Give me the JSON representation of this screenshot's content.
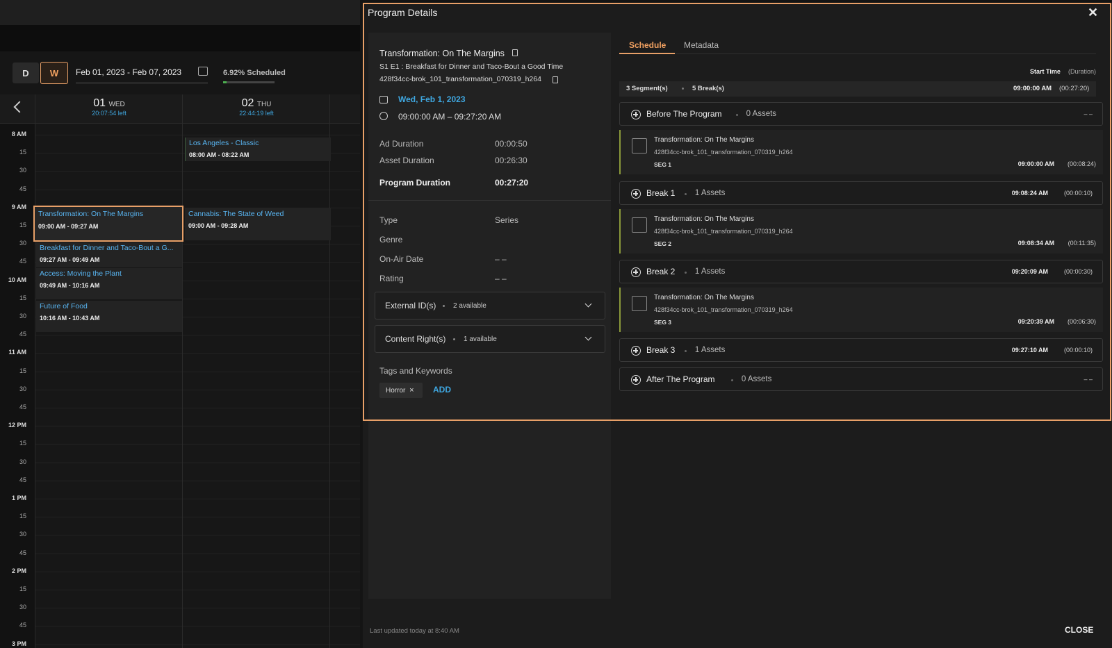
{
  "calendar": {
    "view_d": "D",
    "view_w": "W",
    "date_range": "Feb 01, 2023 - Feb 07, 2023",
    "scheduled": "6.92% Scheduled",
    "scheduled_pct": 6.92,
    "days": [
      {
        "num": "01",
        "wd": "WED",
        "left": "20:07:54 left"
      },
      {
        "num": "02",
        "wd": "THU",
        "left": "22:44:19 left"
      }
    ],
    "times": [
      "8 AM",
      "15",
      "30",
      "45",
      "9 AM",
      "15",
      "30",
      "45",
      "10 AM",
      "15",
      "30",
      "45",
      "11 AM",
      "15",
      "30",
      "45",
      "12 PM",
      "15",
      "30",
      "45",
      "1 PM",
      "15",
      "30",
      "45",
      "2 PM",
      "15",
      "30",
      "45",
      "3 PM"
    ],
    "events": [
      {
        "title": "Transformation: On The Margins",
        "time": "09:00 AM - 09:27 AM"
      },
      {
        "title": "Breakfast for Dinner and Taco-Bout a G...",
        "time": "09:27 AM - 09:49 AM"
      },
      {
        "title": "Access: Moving the Plant",
        "time": "09:49 AM - 10:16 AM"
      },
      {
        "title": "Future of Food",
        "time": "10:16 AM - 10:43 AM"
      },
      {
        "title": "Los Angeles - Classic",
        "time": "08:00 AM - 08:22 AM"
      },
      {
        "title": "Cannabis: The State of Weed",
        "time": "09:00 AM - 09:28 AM"
      }
    ]
  },
  "modal": {
    "title": "Program Details",
    "close_x": "✕",
    "program": {
      "name": "Transformation: On The Margins",
      "episode": "S1 E1 : Breakfast for Dinner and Taco-Bout a Good Time",
      "asset_id": "428f34cc-brok_101_transformation_070319_h264",
      "date": "Wed, Feb 1, 2023",
      "time_range": "09:00:00 AM – 09:27:20 AM",
      "ad_duration_label": "Ad Duration",
      "ad_duration": "00:00:50",
      "asset_duration_label": "Asset Duration",
      "asset_duration": "00:26:30",
      "program_duration_label": "Program Duration",
      "program_duration": "00:27:20",
      "type_label": "Type",
      "type": "Series",
      "genre_label": "Genre",
      "onair_label": "On-Air Date",
      "onair": "– –",
      "rating_label": "Rating",
      "rating": "– –",
      "external_ids": "External ID(s)",
      "external_ids_count": "2 available",
      "content_rights": "Content Right(s)",
      "content_rights_count": "1 available",
      "tags_label": "Tags and Keywords",
      "tag": "Horror",
      "tag_remove": "×",
      "add": "ADD"
    },
    "tabs": [
      "Schedule",
      "Metadata"
    ],
    "start_time": "Start Time",
    "duration": "(Duration)",
    "summary": {
      "segments": "3 Segment(s)",
      "breaks": "5 Break(s)",
      "start": "09:00:00 AM",
      "dur": "(00:27:20)"
    },
    "rows": [
      {
        "kind": "break",
        "name": "Before The Program",
        "assets": "0 Assets",
        "time": "",
        "dur": "– –"
      },
      {
        "kind": "seg",
        "title": "Transformation: On The Margins",
        "id": "428f34cc-brok_101_transformation_070319_h264",
        "seg": "SEG 1",
        "time": "09:00:00 AM",
        "dur": "(00:08:24)"
      },
      {
        "kind": "break",
        "name": "Break 1",
        "assets": "1 Assets",
        "time": "09:08:24 AM",
        "dur": "(00:00:10)"
      },
      {
        "kind": "seg",
        "title": "Transformation: On The Margins",
        "id": "428f34cc-brok_101_transformation_070319_h264",
        "seg": "SEG 2",
        "time": "09:08:34 AM",
        "dur": "(00:11:35)"
      },
      {
        "kind": "break",
        "name": "Break 2",
        "assets": "1 Assets",
        "time": "09:20:09 AM",
        "dur": "(00:00:30)"
      },
      {
        "kind": "seg",
        "title": "Transformation: On The Margins",
        "id": "428f34cc-brok_101_transformation_070319_h264",
        "seg": "SEG 3",
        "time": "09:20:39 AM",
        "dur": "(00:06:30)"
      },
      {
        "kind": "break",
        "name": "Break 3",
        "assets": "1 Assets",
        "time": "09:27:10 AM",
        "dur": "(00:00:10)"
      },
      {
        "kind": "break",
        "name": "After The Program",
        "assets": "0 Assets",
        "time": "",
        "dur": "– –"
      }
    ],
    "footer": "Last updated today at 8:40 AM",
    "close": "CLOSE"
  }
}
